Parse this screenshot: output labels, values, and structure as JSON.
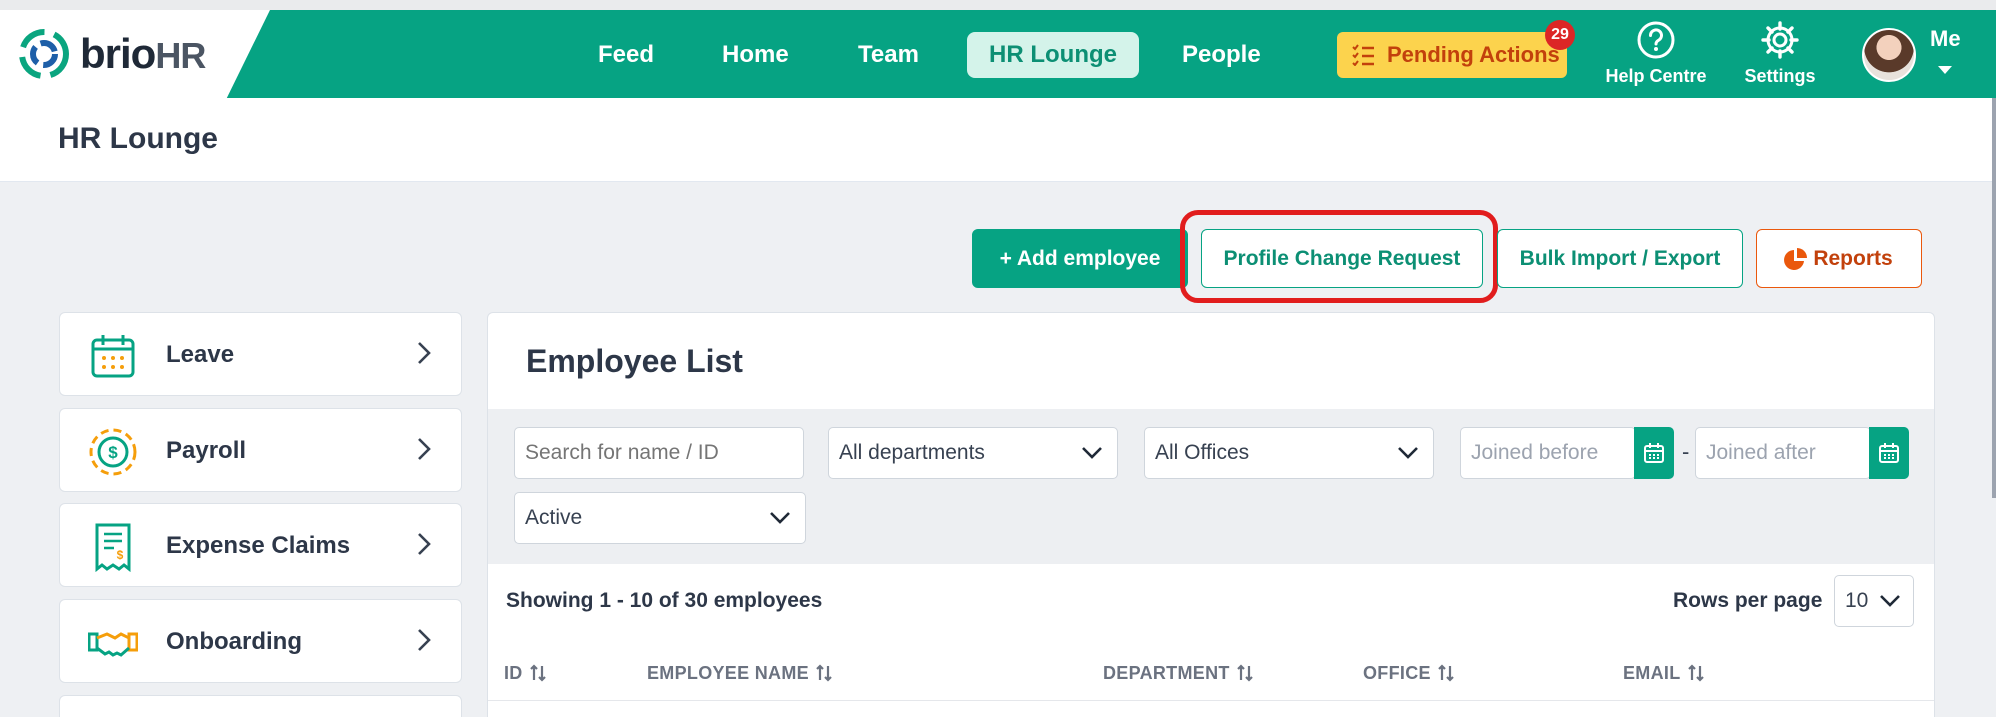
{
  "brand": {
    "name_part1": "brio",
    "name_part2": "HR"
  },
  "nav": {
    "items": [
      {
        "label": "Feed"
      },
      {
        "label": "Home"
      },
      {
        "label": "Team"
      },
      {
        "label": "HR Lounge",
        "active": true
      },
      {
        "label": "People"
      }
    ],
    "pending_actions": {
      "label": "Pending Actions",
      "badge": "29"
    },
    "help_label": "Help Centre",
    "settings_label": "Settings",
    "user_label": "Me"
  },
  "page": {
    "title": "HR Lounge"
  },
  "actions": {
    "add_employee": "+ Add employee",
    "profile_change": "Profile Change Request",
    "bulk_import": "Bulk Import / Export",
    "reports": "Reports"
  },
  "sidebar": {
    "items": [
      {
        "label": "Leave",
        "icon": "calendar-icon"
      },
      {
        "label": "Payroll",
        "icon": "dollar-coin-icon"
      },
      {
        "label": "Expense Claims",
        "icon": "receipt-icon"
      },
      {
        "label": "Onboarding",
        "icon": "handshake-icon"
      }
    ]
  },
  "employee_list": {
    "title": "Employee List",
    "search_placeholder": "Search for name / ID",
    "department_value": "All departments",
    "office_value": "All Offices",
    "joined_before_placeholder": "Joined before",
    "date_separator": "-",
    "joined_after_placeholder": "Joined after",
    "status_value": "Active",
    "showing_text": "Showing 1 - 10 of 30 employees",
    "rows_per_page_label": "Rows per page",
    "rows_per_page_value": "10",
    "columns": [
      "ID",
      "EMPLOYEE NAME",
      "DEPARTMENT",
      "OFFICE",
      "EMAIL"
    ]
  },
  "colors": {
    "brand": "#06a383",
    "pending": "#fcd34d",
    "highlight": "#e11d1d",
    "reports": "#ea580c"
  }
}
